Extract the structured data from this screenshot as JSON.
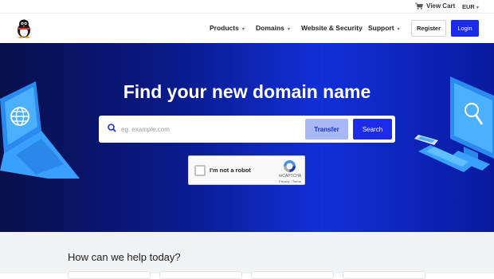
{
  "topbar": {
    "cart_label": "View Cart",
    "currency": "EUR"
  },
  "nav": {
    "items": [
      {
        "label": "Products",
        "has_dropdown": true
      },
      {
        "label": "Domains",
        "has_dropdown": true
      },
      {
        "label": "Website & Security",
        "has_dropdown": false
      },
      {
        "label": "Support",
        "has_dropdown": true
      }
    ],
    "register_label": "Register",
    "login_label": "Login"
  },
  "hero": {
    "title": "Find your new domain name",
    "search": {
      "placeholder": "eg. example.com",
      "value": ""
    },
    "transfer_label": "Transfer",
    "search_label": "Search"
  },
  "captcha": {
    "label": "I'm not a robot",
    "brand": "reCAPTCHA",
    "links": "Privacy - Terms"
  },
  "help": {
    "title": "How can we help today?"
  },
  "colors": {
    "accent": "#1b2be8",
    "hero_dark": "#08104a",
    "transfer_bg": "#a8b8f6",
    "help_bg": "#f1f2f4"
  }
}
